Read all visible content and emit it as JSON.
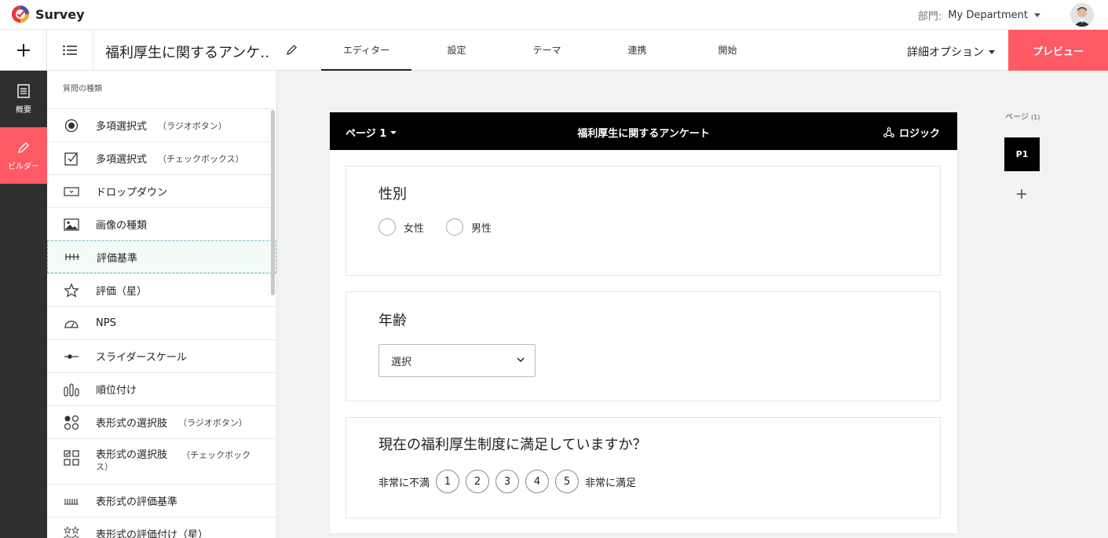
{
  "app": {
    "name": "Survey"
  },
  "header": {
    "dept_label": "部門:",
    "dept_value": "My Department"
  },
  "toolbar": {
    "survey_title": "福利厚生に関するアンケ…",
    "tabs": [
      {
        "label": "エディター",
        "active": true
      },
      {
        "label": "設定"
      },
      {
        "label": "テーマ"
      },
      {
        "label": "連携"
      },
      {
        "label": "開始"
      }
    ],
    "advanced_options": "詳細オプション",
    "preview": "プレビュー"
  },
  "rail": {
    "items": [
      {
        "label": "概要"
      },
      {
        "label": "ビルダー",
        "active": true
      }
    ]
  },
  "question_types": {
    "title": "質問の種類",
    "items": [
      {
        "label": "多項選択式",
        "sub": "（ラジオボタン）",
        "icon": "radio-icon"
      },
      {
        "label": "多項選択式",
        "sub": "（チェックボックス）",
        "icon": "checkbox-icon"
      },
      {
        "label": "ドロップダウン",
        "sub": "",
        "icon": "dropdown-icon"
      },
      {
        "label": "画像の種類",
        "sub": "",
        "icon": "image-icon"
      },
      {
        "label": "評価基準",
        "sub": "",
        "icon": "scale-icon"
      },
      {
        "label": "評価（星）",
        "sub": "",
        "icon": "star-icon"
      },
      {
        "label": "NPS",
        "sub": "",
        "icon": "gauge-icon"
      },
      {
        "label": "スライダースケール",
        "sub": "",
        "icon": "slider-icon"
      },
      {
        "label": "順位付け",
        "sub": "",
        "icon": "ranking-icon"
      },
      {
        "label": "表形式の選択肢",
        "sub": "（ラジオボタン）",
        "icon": "matrix-radio-icon"
      },
      {
        "label": "表形式の選択肢",
        "sub": "（チェックボックス）",
        "icon": "matrix-checkbox-icon"
      },
      {
        "label": "表形式の評価基準",
        "sub": "",
        "icon": "matrix-scale-icon"
      },
      {
        "label": "表形式の評価付け（星）",
        "sub": "",
        "icon": "matrix-star-icon"
      }
    ]
  },
  "page": {
    "label": "ページ 1",
    "title": "福利厚生に関するアンケート",
    "logic": "ロジック"
  },
  "questions": {
    "q1": {
      "title": "性別",
      "options": [
        "女性",
        "男性"
      ]
    },
    "q2": {
      "title": "年齢",
      "select_value": "選択"
    },
    "q3": {
      "title": "現在の福利厚生制度に満足していますか？",
      "low_label": "非常に不満",
      "high_label": "非常に満足",
      "scale": [
        "1",
        "2",
        "3",
        "4",
        "5"
      ]
    }
  },
  "pages_panel": {
    "label": "ページ",
    "count": "(1)",
    "chip": "P1"
  },
  "colors": {
    "accent": "#fe5a64",
    "dark": "#2f2f2f"
  }
}
